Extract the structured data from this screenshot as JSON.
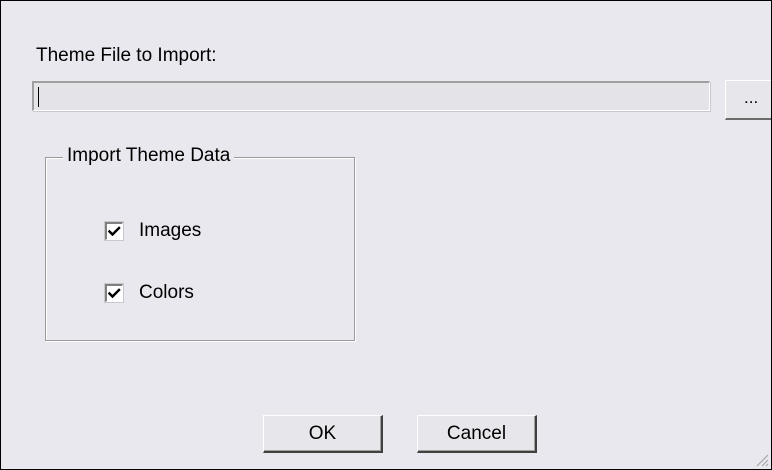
{
  "dialog": {
    "file_label": "Theme File to Import:",
    "file_input": {
      "value": "",
      "placeholder": ""
    },
    "browse_label": "...",
    "group": {
      "title": "Import Theme Data",
      "options": [
        {
          "label": "Images",
          "checked": true
        },
        {
          "label": "Colors",
          "checked": true
        }
      ]
    },
    "buttons": {
      "ok": "OK",
      "cancel": "Cancel"
    }
  },
  "colors": {
    "dialog_background": "#e9e8ee",
    "input_background": "#e4e3e8",
    "checkbox_background": "#ffffff"
  },
  "icons": {
    "check": "checkmark-icon",
    "grip": "resize-grip-icon"
  }
}
